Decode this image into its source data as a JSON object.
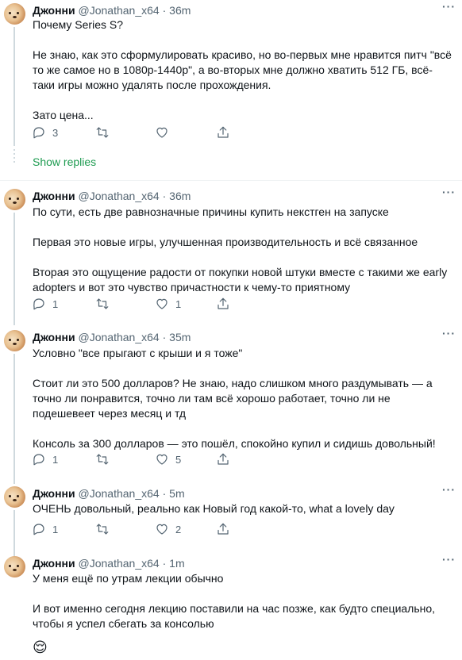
{
  "tweets": [
    {
      "name": "Джонни",
      "handle": "@Jonathan_x64",
      "dot": "·",
      "time": "36m",
      "paragraphs": [
        "Почему Series S?",
        "Не знаю, как это сформулировать красиво, но во-первых мне нравится питч \"всё то же самое но в 1080p-1440p\", а во-вторых мне должно хватить 512 ГБ, всё-таки игры можно удалять после прохождения.",
        "Зато цена..."
      ],
      "replies": "3",
      "retweets": "",
      "likes": ""
    },
    {
      "name": "Джонни",
      "handle": "@Jonathan_x64",
      "dot": "·",
      "time": "36m",
      "paragraphs": [
        "По сути, есть две равнозначные причины купить некстген на запуске",
        "Первая это новые игры, улучшенная производительность и всё связанное",
        "Вторая это ощущение радости от покупки новой штуки вместе с такими же early adopters и вот это чувство причастности к чему-то приятному"
      ],
      "replies": "1",
      "retweets": "",
      "likes": "1"
    },
    {
      "name": "Джонни",
      "handle": "@Jonathan_x64",
      "dot": "·",
      "time": "35m",
      "paragraphs": [
        "Условно \"все прыгают с крыши и я тоже\"",
        "Стоит ли это 500 долларов? Не знаю, надо слишком много раздумывать — а точно ли понравится, точно ли там всё хорошо работает, точно ли не подешевеет через месяц и тд",
        "Консоль за 300 долларов — это пошёл, спокойно купил и сидишь довольный!"
      ],
      "replies": "1",
      "retweets": "",
      "likes": "5"
    },
    {
      "name": "Джонни",
      "handle": "@Jonathan_x64",
      "dot": "·",
      "time": "5m",
      "paragraphs": [
        "ОЧЕНЬ довольный, реально как Новый год какой-то, what a lovely day"
      ],
      "replies": "1",
      "retweets": "",
      "likes": "2"
    },
    {
      "name": "Джонни",
      "handle": "@Jonathan_x64",
      "dot": "·",
      "time": "1m",
      "paragraphs": [
        "У меня ещё по утрам лекции обычно",
        "И вот именно сегодня лекцию поставили на час позже, как будто специально, чтобы я успел сбегать за консолью"
      ],
      "emoji": "😌"
    }
  ],
  "show_replies": "Show replies",
  "more_glyph": "···",
  "colors": {
    "text": "#0f1419",
    "muted": "#536471",
    "link_green": "#1d9b50",
    "thread_line": "#cfd9de",
    "divider": "#eff3f4"
  },
  "icons": [
    "reply-icon",
    "retweet-icon",
    "like-icon",
    "share-icon",
    "more-icon"
  ]
}
